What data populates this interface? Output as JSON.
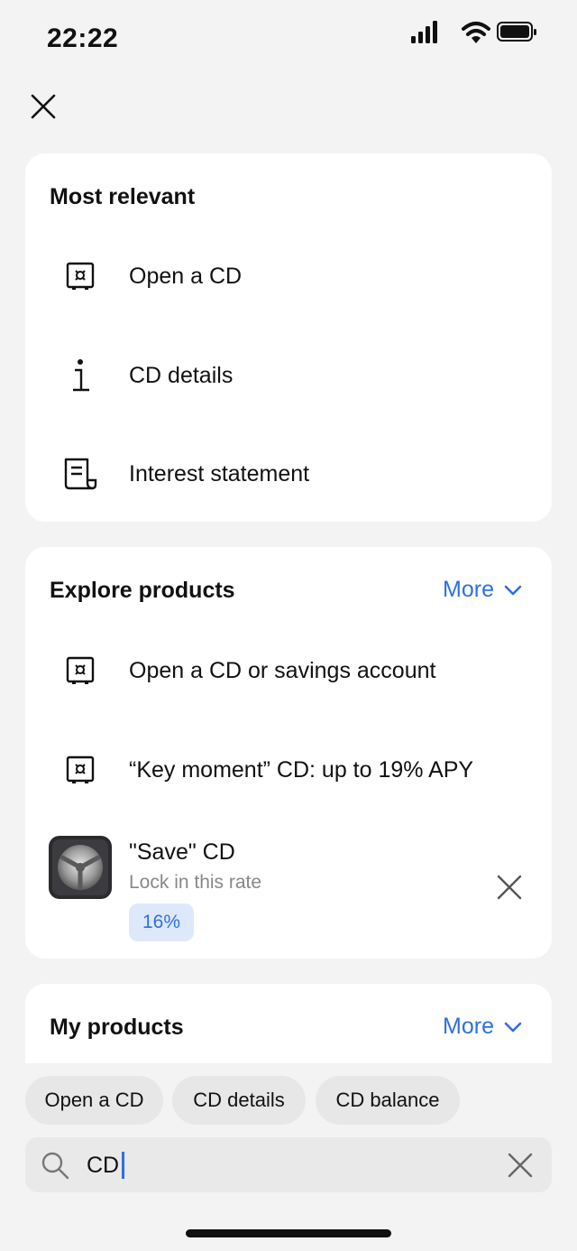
{
  "status": {
    "time": "22:22"
  },
  "most_relevant": {
    "title": "Most relevant",
    "items": [
      {
        "label": "Open a CD",
        "icon": "safe-icon"
      },
      {
        "label": "CD details",
        "icon": "info-icon"
      },
      {
        "label": "Interest statement",
        "icon": "document-icon"
      }
    ]
  },
  "explore_products": {
    "title": "Explore products",
    "more_label": "More",
    "items": [
      {
        "label": "Open a CD or savings account",
        "icon": "safe-icon"
      },
      {
        "label": "“Key moment” CD: up to 19% APY",
        "icon": "safe-icon"
      }
    ],
    "promo": {
      "title": "\"Save\" CD",
      "subtitle": "Lock in this rate",
      "badge": "16%"
    }
  },
  "my_products": {
    "title": "My products",
    "more_label": "More"
  },
  "suggestions": [
    "Open a CD",
    "CD details",
    "CD balance"
  ],
  "search": {
    "value": "CD"
  },
  "colors": {
    "accent": "#2f6fe0",
    "badge_bg": "#dde9fb",
    "background": "#f3f3f3",
    "card": "#ffffff"
  }
}
